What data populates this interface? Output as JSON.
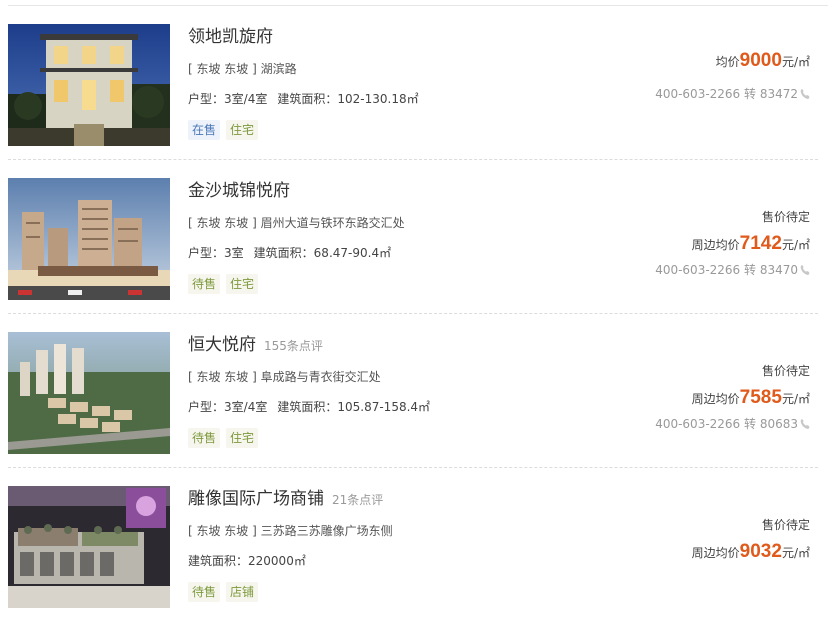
{
  "listings": [
    {
      "name": "领地凯旋府",
      "reviews": "",
      "location": "[ 东坡 东坡 ] 湖滨路",
      "layout_label": "户型：",
      "layout": "3室/4室",
      "area_label": "建筑面积：",
      "area": "102-130.18㎡",
      "tags": [
        "在售",
        "住宅"
      ],
      "status": "",
      "price_label": "均价",
      "price": "9000",
      "price_unit": "元/㎡",
      "phone": "400-603-2266 转 83472",
      "image": "villa-night-photo"
    },
    {
      "name": "金沙城锦悦府",
      "reviews": "",
      "location": "[ 东坡 东坡 ] 眉州大道与铁环东路交汇处",
      "layout_label": "户型：",
      "layout": "3室",
      "area_label": "建筑面积：",
      "area": "68.47-90.4㎡",
      "tags": [
        "待售",
        "住宅"
      ],
      "status": "售价待定",
      "price_label": "周边均价",
      "price": "7142",
      "price_unit": "元/㎡",
      "phone": "400-603-2266 转 83470",
      "image": "tower-rendering"
    },
    {
      "name": "恒大悦府",
      "reviews": "155条点评",
      "location": "[ 东坡 东坡 ] 阜成路与青衣街交汇处",
      "layout_label": "户型：",
      "layout": "3室/4室",
      "area_label": "建筑面积：",
      "area": "105.87-158.4㎡",
      "tags": [
        "待售",
        "住宅"
      ],
      "status": "售价待定",
      "price_label": "周边均价",
      "price": "7585",
      "price_unit": "元/㎡",
      "phone": "400-603-2266 转 80683",
      "image": "aerial-complex-rendering"
    },
    {
      "name": "雕像国际广场商铺",
      "reviews": "21条点评",
      "location": "[ 东坡 东坡 ] 三苏路三苏雕像广场东侧",
      "layout_label": "",
      "layout": "",
      "area_label": "建筑面积：",
      "area": "220000㎡",
      "tags": [
        "待售",
        "店铺"
      ],
      "status": "售价待定",
      "price_label": "周边均价",
      "price": "9032",
      "price_unit": "元/㎡",
      "phone": "",
      "image": "sales-model-photo"
    }
  ],
  "colors": {
    "price": "#e05a1b",
    "tag_on_sale": "#4a78b8",
    "tag_pending": "#7e9a3e"
  },
  "icons": {
    "phone": "phone-icon"
  }
}
